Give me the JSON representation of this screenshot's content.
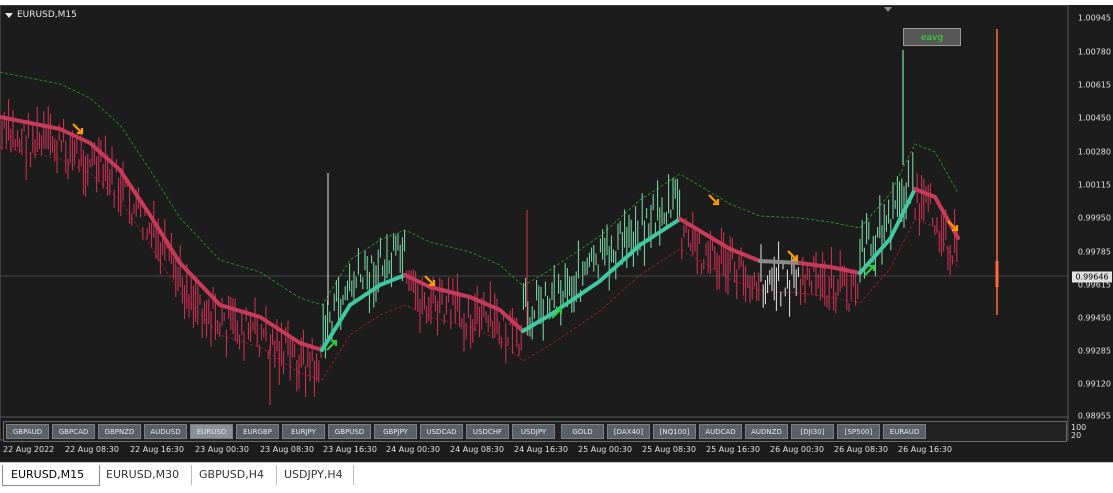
{
  "chart": {
    "symbol": "EURUSD,M15",
    "current_price_label": "0.99646",
    "price_axis_labels": [
      "1.00945",
      "1.00780",
      "1.00615",
      "1.00450",
      "1.00280",
      "1.00115",
      "0.99950",
      "0.99785",
      "0.99615",
      "0.99450",
      "0.99285",
      "0.99120",
      "0.98955"
    ],
    "indicator_axis_labels": [
      "100",
      "20"
    ],
    "eavg_label": "eavg",
    "time_axis_labels": [
      "22 Aug 2022",
      "22 Aug 08:30",
      "22 Aug 16:30",
      "23 Aug 00:30",
      "23 Aug 08:30",
      "23 Aug 16:30",
      "24 Aug 00:30",
      "24 Aug 08:30",
      "24 Aug 16:30",
      "25 Aug 00:30",
      "25 Aug 08:30",
      "25 Aug 16:30",
      "26 Aug 00:30",
      "26 Aug 08:30",
      "26 Aug 16:30"
    ]
  },
  "symbol_buttons": [
    "GBPAUD",
    "GBPCAD",
    "GBPNZD",
    "AUDUSD",
    "EURUSD",
    "EURGBP",
    "EURJPY",
    "GBPUSD",
    "GBPJPY",
    "USDCAD",
    "USDCHF",
    "USDJPY",
    "GOLD",
    "[DAX40]",
    "[NQ100]",
    "AUDCAD",
    "AUDNZD",
    "[DJI30]",
    "[SP500]",
    "EURAUD"
  ],
  "active_symbol": "EURUSD",
  "tabs": [
    {
      "label": "EURUSD,M15",
      "active": true
    },
    {
      "label": "EURUSD,M30",
      "active": false
    },
    {
      "label": "GBPUSD,H4",
      "active": false
    },
    {
      "label": "USDJPY,H4",
      "active": false
    }
  ],
  "colors": {
    "background": "#1c1c1c",
    "bull_bar": "#7fe0b0",
    "bear_bar": "#d8325a",
    "neutral_bar": "#e6e6e6",
    "ma_up": "#40c8a0",
    "ma_down": "#c83a5a",
    "ma_flat": "#8a8a8a",
    "signal_up_arrow": "#2ecc40",
    "signal_down_arrow": "#ff9a00",
    "vertical_marker": "#ff6a3a"
  }
}
